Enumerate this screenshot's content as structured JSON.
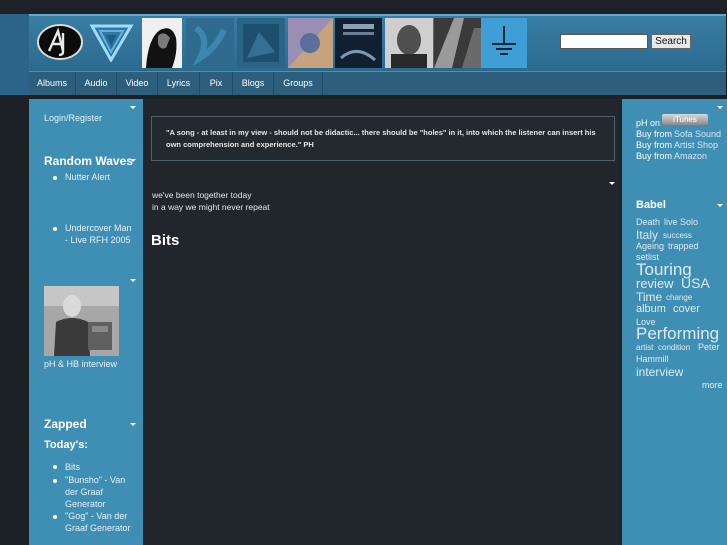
{
  "search": {
    "placeholder": "",
    "button_label": "Search"
  },
  "nav": [
    "Albums",
    "Audio",
    "Video",
    "Lyrics",
    "Pix",
    "Blogs",
    "Groups"
  ],
  "left": {
    "login_label": "Login/Register",
    "random_waves": {
      "title": "Random Waves",
      "items": [
        "Nutter Alert",
        "Undercover Man - Live RFH 2005"
      ]
    },
    "photo_caption": "pH & HB interview",
    "zapped": {
      "title": "Zapped",
      "todays_label": "Today's:",
      "items": [
        "Bits",
        "\"Bunsho\" - Van der Graaf Generator",
        "\"Gog\" - Van der Graaf Generator"
      ]
    }
  },
  "main": {
    "quote": "\"A song - at least in my view - should not be didactic... there should be \"holes\" in it, into which the listener can insert his own comprehension and experience.\" PH",
    "line1": "we've been together today",
    "line2": "in a way we might never repeat",
    "title": "Bits"
  },
  "right": {
    "ph_on": "pH on",
    "itunes_label": "iTunes",
    "buy_sofa_prefix": "Buy from",
    "buy_sofa": "Sofa Sound",
    "buy_shop_prefix": "Buy from",
    "buy_shop": "Artist Shop",
    "buy_amazon_prefix": "Buy from",
    "buy_amazon": "Amazon",
    "babel_title": "Babel",
    "tags": [
      "Death",
      "live",
      "Solo",
      "Italy",
      "success",
      "Ageing",
      "trapped",
      "setlist",
      "Touring",
      "review",
      "USA",
      "Time",
      "change",
      "album",
      "cover",
      "Love",
      "Performing",
      "artist",
      "condition",
      "Peter",
      "Hammill",
      "interview"
    ],
    "more_label": "more"
  },
  "colors": {
    "sidebar": "#3f8fb4",
    "main_bg": "#20262b",
    "header": "#3a7ea3",
    "nav": "#2d5f7d"
  }
}
